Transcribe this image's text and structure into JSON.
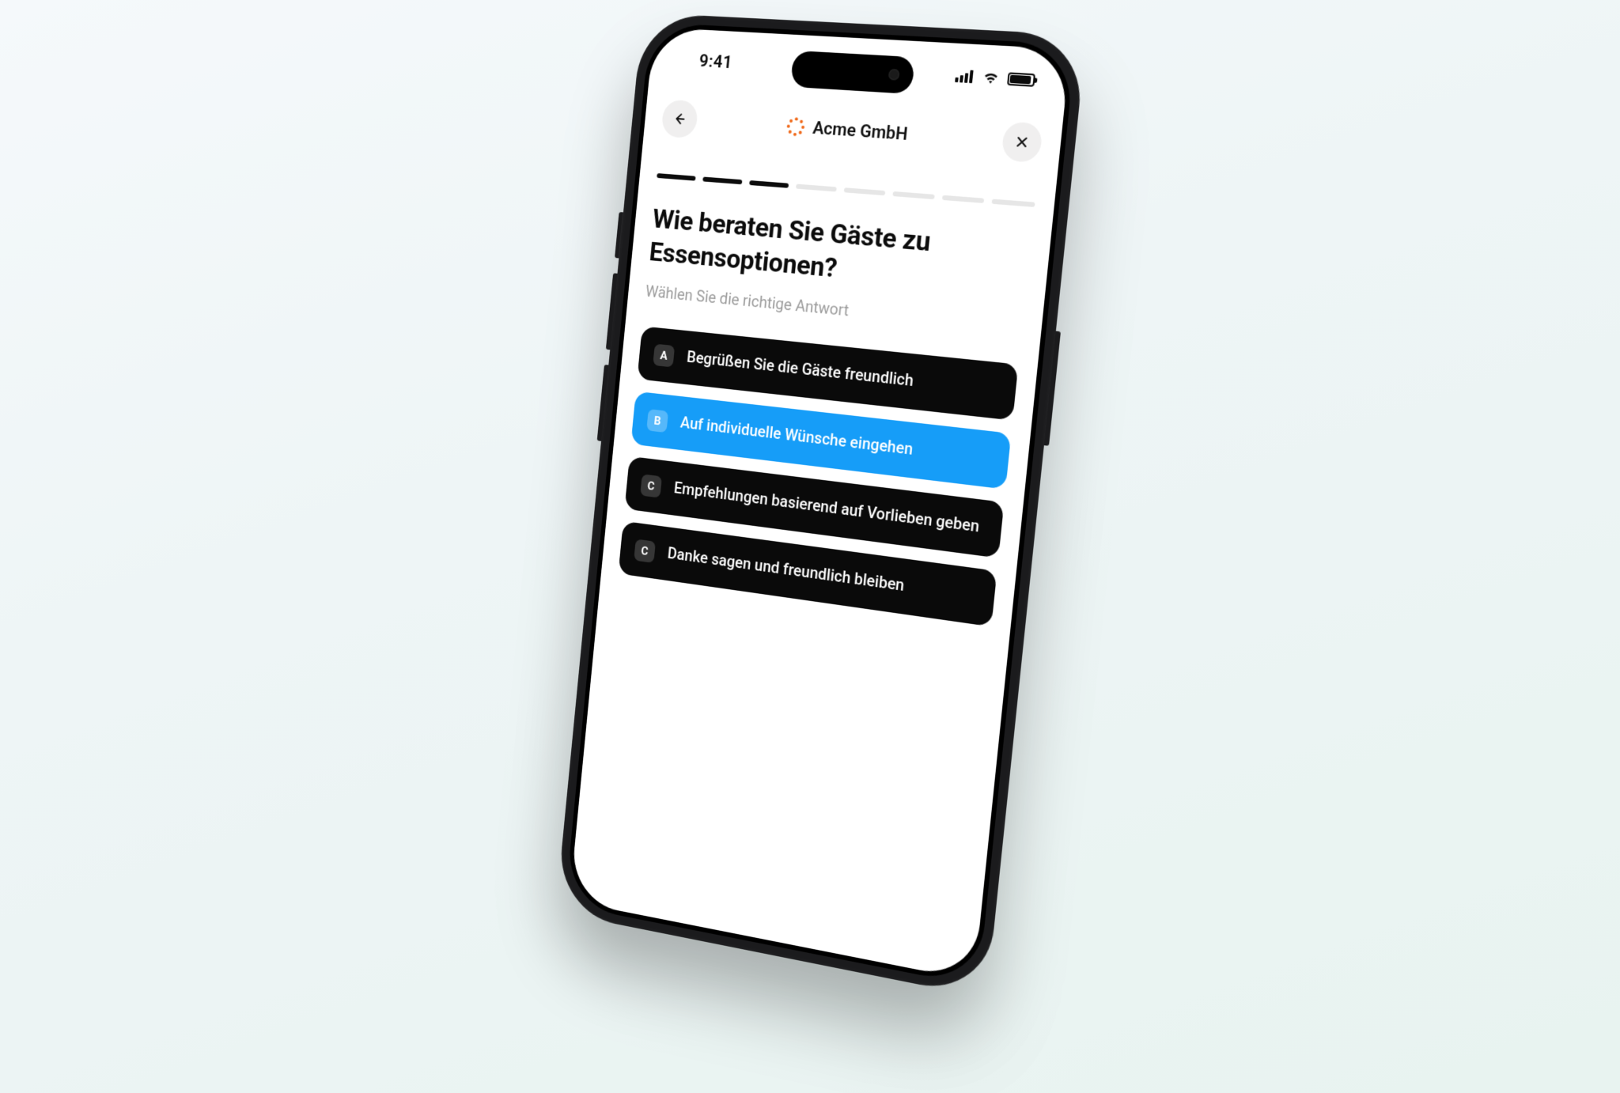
{
  "status": {
    "time": "9:41"
  },
  "nav": {
    "title": "Acme GmbH"
  },
  "progress": {
    "total": 8,
    "completed": 3
  },
  "question": "Wie beraten Sie Gäste zu Essensoptionen?",
  "instruction": "Wählen Sie die richtige Antwort",
  "options": [
    {
      "key": "A",
      "text": "Begrüßen Sie die Gäste freundlich",
      "selected": false
    },
    {
      "key": "B",
      "text": "Auf individuelle Wünsche eingehen",
      "selected": true
    },
    {
      "key": "C",
      "text": "Empfehlungen basierend auf Vorlieben geben",
      "selected": false
    },
    {
      "key": "C",
      "text": "Danke sagen und freundlich bleiben",
      "selected": false
    }
  ],
  "colors": {
    "accent": "#169df8",
    "brand": "#f06a1b"
  }
}
